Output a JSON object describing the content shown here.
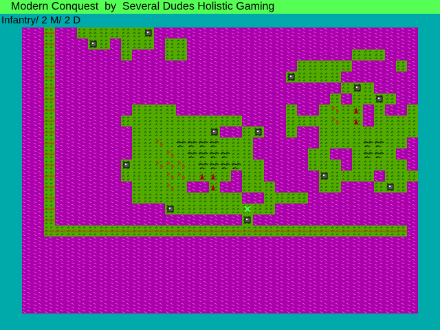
{
  "window": {
    "title": "Modern Conquest  by  Several Dudes Holistic Gaming"
  },
  "status": {
    "unit_info": "Infantry/ 2 M/ 2 D"
  },
  "map": {
    "cols": 36,
    "rows": 26,
    "tile_size": 16,
    "colors": {
      "sea": "#AA00AA",
      "wave": "#FF55FF",
      "land": "#55AA00",
      "grass": "#005500",
      "forest": "#AA5500",
      "hills": "#000000",
      "mountain": "#AA0000",
      "road": "#AA5500",
      "city_fill": "#555555",
      "city_border": "#000000",
      "unit": "#55FF55",
      "frame": "#00AAAA"
    },
    "legend": "~ sea, . land, = road, f forest, h hills, m mountains, c city, u unit",
    "tiles": [
      "~~=~~......c~~~~~~~~~~~~~~~~~~~~~~~~",
      "~~=~~~c.~...~..~~~~~~~~~~~~~~~~~~~~~",
      "~~=~~~~~~.~~~..~~~~~~~~~~~~~~~...~~~",
      "~~=~~~~~~~~~~~~~~~~~~~~~~.....~~~~.~",
      "~~=~~~~~~~~~~~~~~~~~~~~~c....~~~~~~~",
      "~~=~~~~~~~~~~~~~~~~~~~~~~~~~~.c.~~~~",
      "~~=~~~~~~~~~~~~~~~~~~~~~~~~~.~..c.~~",
      "~~=~~~~~~~....~~~~~~~~~~.~~.f.m~.~~.",
      "~~=~~~~~~...........~~~~....f.m~....",
      "~~=~~~~~~~.......c~~.c~~.~~...........",
      "~~=~~~~~~~..f.hhhh...~~~~~~....hh..~",
      "~~=~~~~~~~...f.hhhh..~~~~~..~~.hh.~~",
      "~~=~~~~~~c..fff.hhhh..~~~~...~.....~",
      "~~=~~~~~~....ff.mm.~..~~~~~c....~...",
      "~~=~~~~~~~...f.~~m~~...~~~~..~~~.c.~",
      "~~=~~~~~~~..........~~....~~~~~~~~~~",
      "~~=~~~~~~~~~~c......u..~~~~~~~~~~~~~",
      "~~=~~~~~~~~~~~~~~~~~c~~~~~~~~~~~~~~~",
      "~~=================================",
      "~~~~~~~~~~~~~~~~~~~~~~~~~~~~~~~~~~~~",
      "~~~~~~~~~~~~~~~~~~~~~~~~~~~~~~~~~~~~",
      "~~~~~~~~~~~~~~~~~~~~~~~~~~~~~~~~~~~~",
      "~~~~~~~~~~~~~~~~~~~~~~~~~~~~~~~~~~~~",
      "~~~~~~~~~~~~~~~~~~~~~~~~~~~~~~~~~~~~",
      "~~~~~~~~~~~~~~~~~~~~~~~~~~~~~~~~~~~~",
      "~~~~~~~~~~~~~~~~~~~~~~~~~~~~~~~~~~~~"
    ]
  }
}
